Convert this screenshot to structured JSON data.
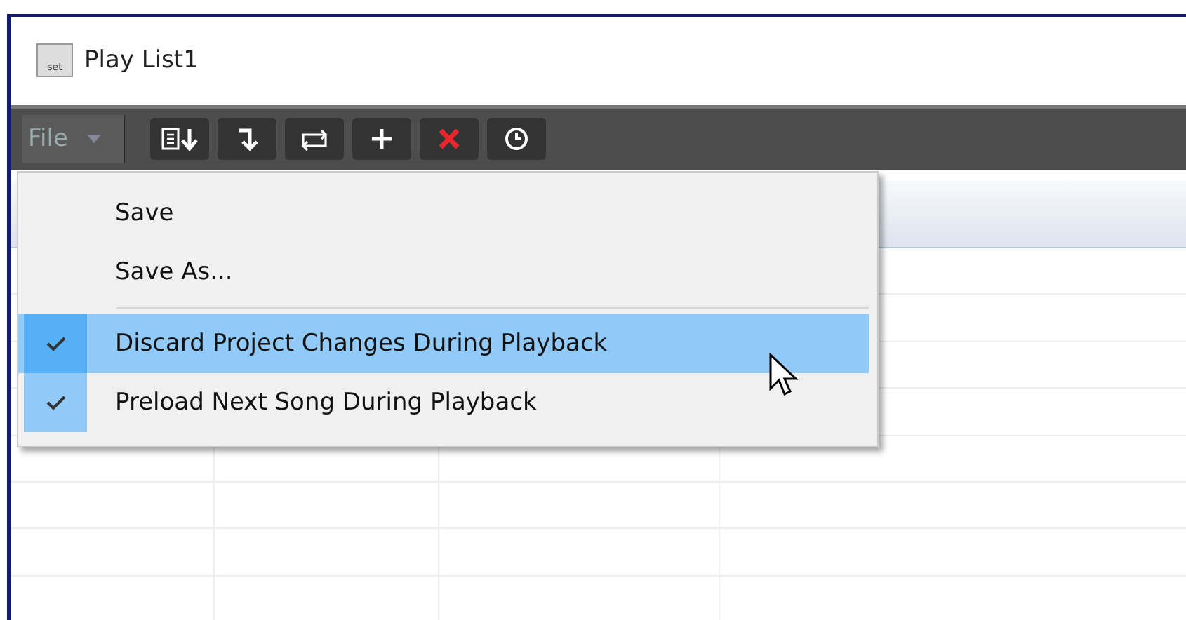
{
  "window": {
    "title": "Play List1",
    "icon_label": "set"
  },
  "menu_bar": {
    "label": "File",
    "open": true
  },
  "file_menu": [
    {
      "kind": "item",
      "label": "Save",
      "checked": false,
      "selected": false
    },
    {
      "kind": "item",
      "label": "Save As...",
      "checked": false,
      "selected": false
    },
    {
      "kind": "separator"
    },
    {
      "kind": "check",
      "label": "Discard Project Changes During Playback",
      "checked": true,
      "selected": true
    },
    {
      "kind": "check",
      "label": "Preload Next Song During Playback",
      "checked": true,
      "selected": false
    }
  ]
}
